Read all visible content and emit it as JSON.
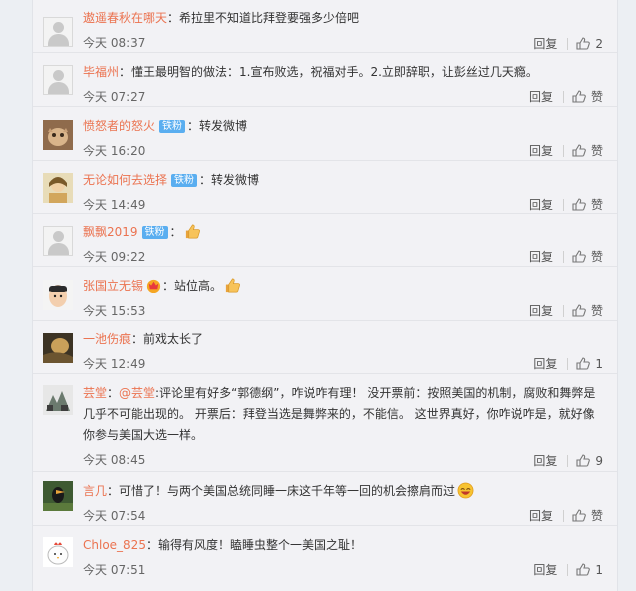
{
  "comments": [
    {
      "name": "遨遥春秋在哪天",
      "sep": "：",
      "text": "希拉里不知道比拜登要强多少倍吧",
      "time": "今天 08:37",
      "reply": "回复",
      "likes": "2"
    },
    {
      "name": "毕福州",
      "sep": "：",
      "text": "懂王最明智的做法：1.宣布败选，祝福对手。2.立即辞职，让彭丝过几天瘾。",
      "time": "今天 07:27",
      "reply": "回复",
      "likes": "赞"
    },
    {
      "name": "愤怒者的怒火",
      "badge": "铁粉",
      "sep": "：",
      "text": "转发微博",
      "time": "今天 16:20",
      "reply": "回复",
      "likes": "赞"
    },
    {
      "name": "无论如何去选择",
      "badge": "铁粉",
      "sep": "：",
      "text": "转发微博",
      "time": "今天 14:49",
      "reply": "回复",
      "likes": "赞"
    },
    {
      "name": "飘飘2019",
      "badge": "铁粉",
      "sep": "：",
      "text": "",
      "time": "今天 09:22",
      "reply": "回复",
      "likes": "赞"
    },
    {
      "name": "张国立无锡",
      "sep": "：",
      "text": "站位高。",
      "time": "今天 15:53",
      "reply": "回复",
      "likes": "赞"
    },
    {
      "name": "一池伤痕",
      "sep": "：",
      "text": "前戏太长了",
      "time": "今天 12:49",
      "reply": "回复",
      "likes": "1"
    },
    {
      "name": "芸堂",
      "sep": "：",
      "mention": "@芸堂",
      "text": ":评论里有好多“郭德纲”，咋说咋有理！ 没开票前：按照美国的机制，腐败和舞弊是几乎不可能出现的。 开票后：拜登当选是舞弊来的，不能信。 这世界真好，你咋说咋是，就好像你参与美国大选一样。",
      "time": "今天 08:45",
      "reply": "回复",
      "likes": "9"
    },
    {
      "name": "言几",
      "sep": "：",
      "text": "可惜了！与两个美国总统同睡一床这千年等一回的机会擦肩而过",
      "time": "今天 07:54",
      "reply": "回复",
      "likes": "赞"
    },
    {
      "name": "Chloe_825",
      "sep": "：",
      "text": "输得有风度！瞌睡虫整个一美国之耻！",
      "time": "今天 07:51",
      "reply": "回复",
      "likes": "1"
    }
  ]
}
